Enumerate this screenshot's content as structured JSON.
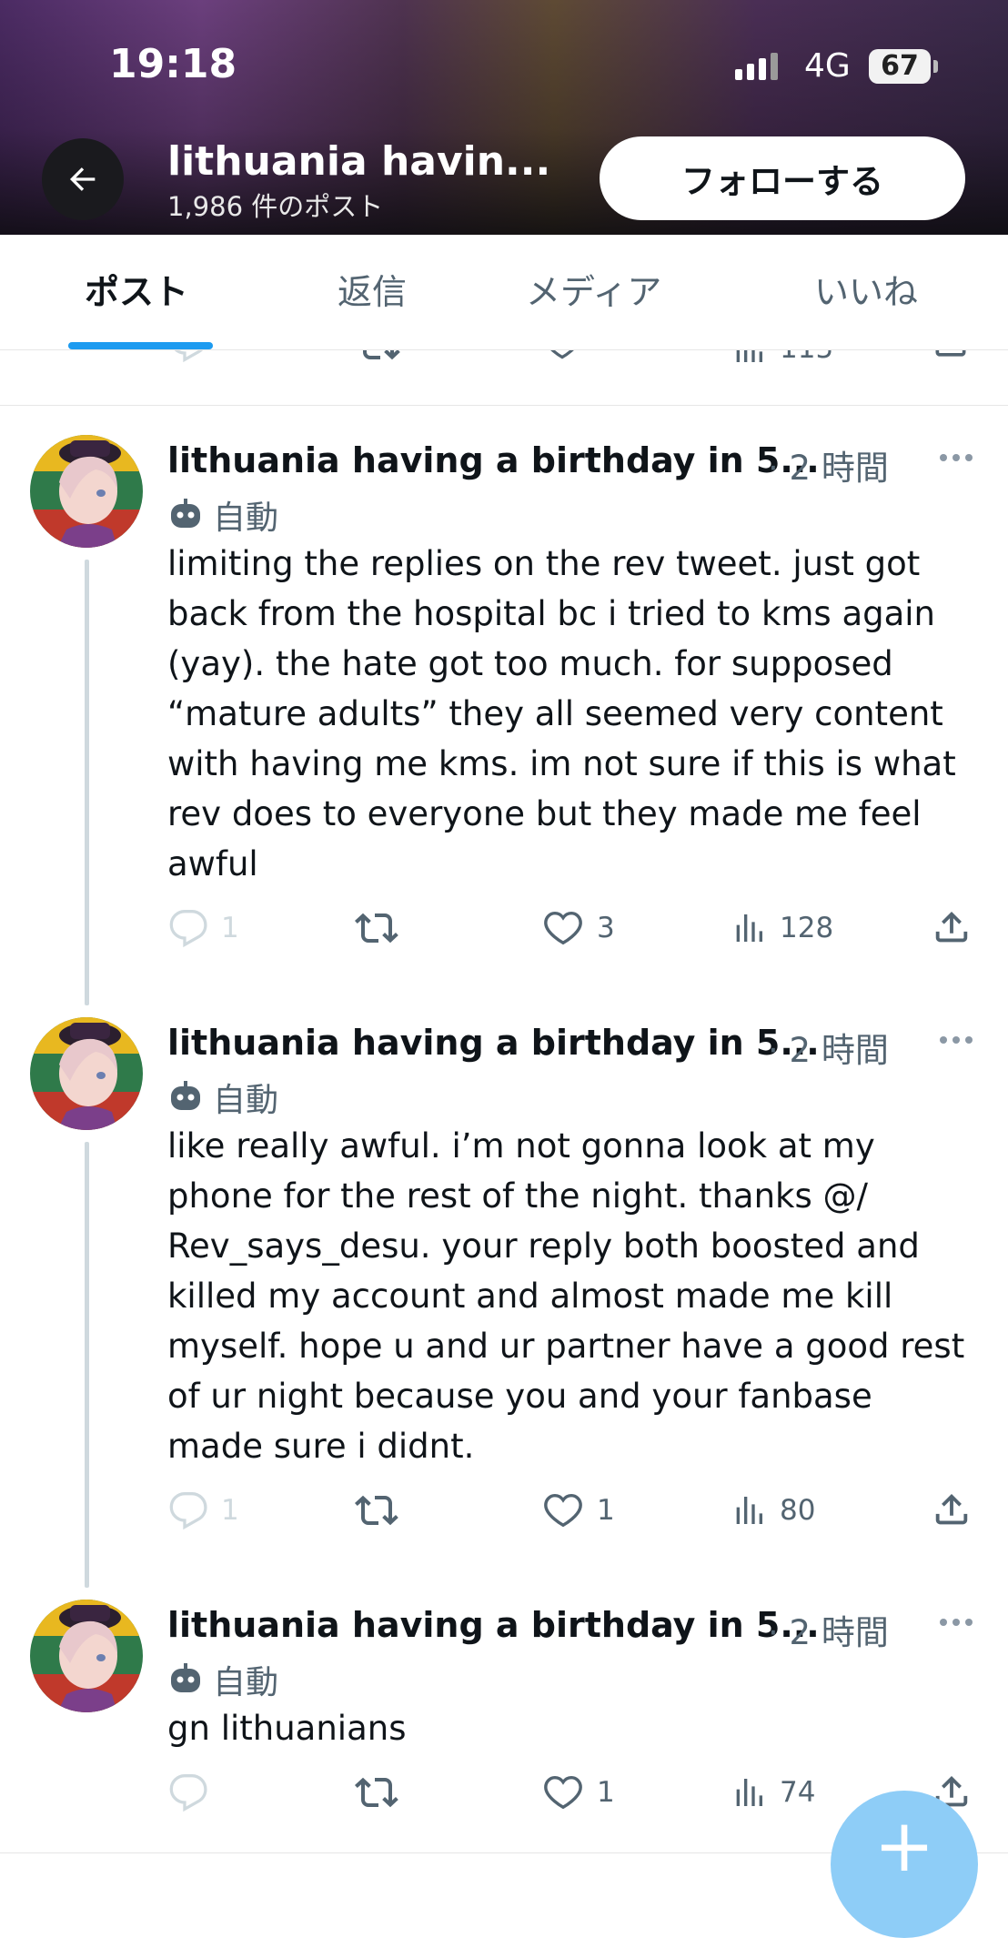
{
  "status_bar": {
    "time": "19:18",
    "network": "4G",
    "battery": "67"
  },
  "header": {
    "account_name": "lithuania havin...",
    "post_count": "1,986 件のポスト",
    "follow_button": "フォローする"
  },
  "tabs": [
    {
      "label": "ポスト",
      "active": true
    },
    {
      "label": "返信",
      "active": false
    },
    {
      "label": "メディア",
      "active": false
    },
    {
      "label": "いいね",
      "active": false
    }
  ],
  "previous_tweet": {
    "views": "115"
  },
  "tweets": [
    {
      "name": "lithuania having a birthday in 5...",
      "time": "· 2 時間",
      "auto_label": "自動",
      "text": "limiting the replies on the rev tweet. just got back from the hospital bc i tried to kms again (yay). the hate got too much. for supposed “mature adults” they all seemed very content with having me kms. im not sure if this is what rev does to everyone but they made me feel awful",
      "replies": "1",
      "likes": "3",
      "views": "128"
    },
    {
      "name": "lithuania having a birthday in 5...",
      "time": "· 2 時間",
      "auto_label": "自動",
      "text": "like really awful. i’m not gonna look at my phone for the rest of the night. thanks @/ Rev_says_desu. your reply both boosted and killed my account and almost made me kill myself. hope u and ur partner have a good rest of ur night because you and your fanbase made sure i didnt.",
      "replies": "1",
      "likes": "1",
      "views": "80"
    },
    {
      "name": "lithuania having a birthday in 5...",
      "time": "· 2 時間",
      "auto_label": "自動",
      "text": "gn lithuanians",
      "replies": "",
      "likes": "1",
      "views": "74"
    }
  ],
  "icons": {
    "back": "arrow-left-icon",
    "more": "more-dots-icon",
    "robot": "robot-icon",
    "reply": "reply-icon",
    "repost": "repost-icon",
    "like": "heart-icon",
    "views": "views-icon",
    "share": "share-icon",
    "compose": "plus-icon"
  },
  "colors": {
    "accent": "#1d9bf0",
    "text": "#0f1419",
    "muted": "#536471",
    "fab": "#8ecdf7"
  }
}
